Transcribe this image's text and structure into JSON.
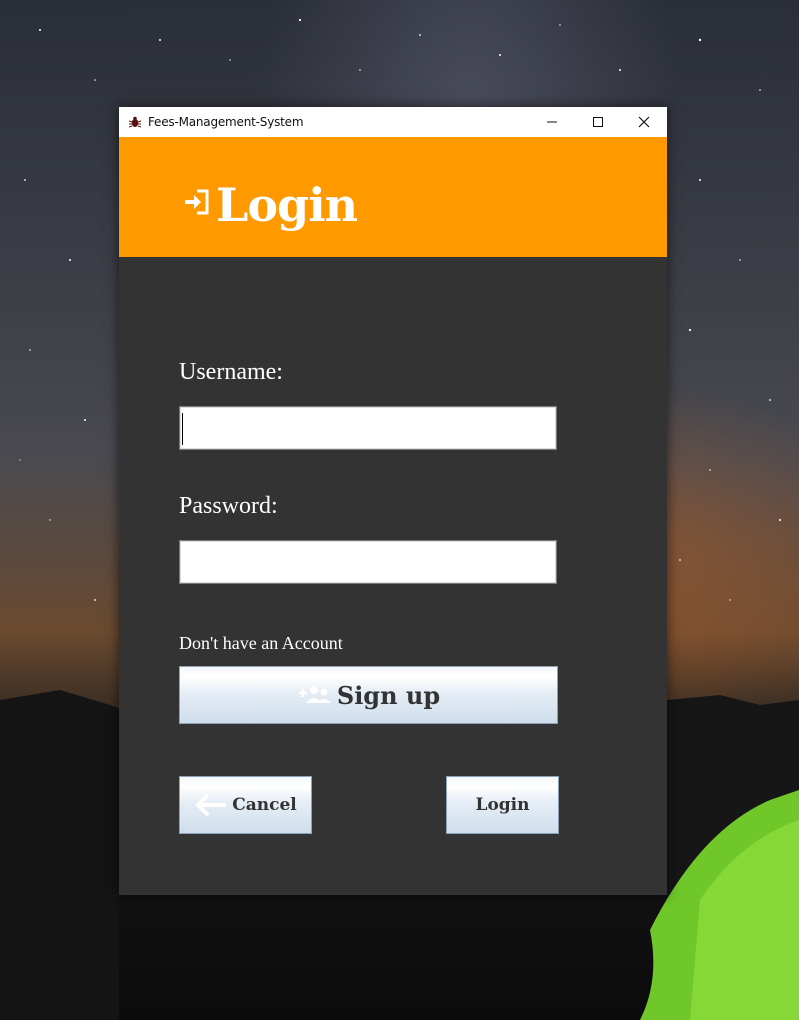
{
  "window": {
    "title": "Fees-Management-System",
    "controls": [
      "minimize",
      "maximize",
      "close"
    ]
  },
  "header": {
    "icon": "login-arrow-icon",
    "title": "Login",
    "background_color": "#ff9900"
  },
  "form": {
    "username_label": "Username:",
    "username_value": "",
    "password_label": "Password:",
    "password_value": "",
    "account_prompt": "Don't have an Account",
    "signup_label": "Sign up",
    "signup_icon": "add-users-icon",
    "cancel_label": "Cancel",
    "cancel_icon": "arrow-left-icon",
    "login_label": "Login"
  },
  "colors": {
    "panel": "#333333",
    "accent": "#ff9900",
    "button_text": "#333333"
  }
}
